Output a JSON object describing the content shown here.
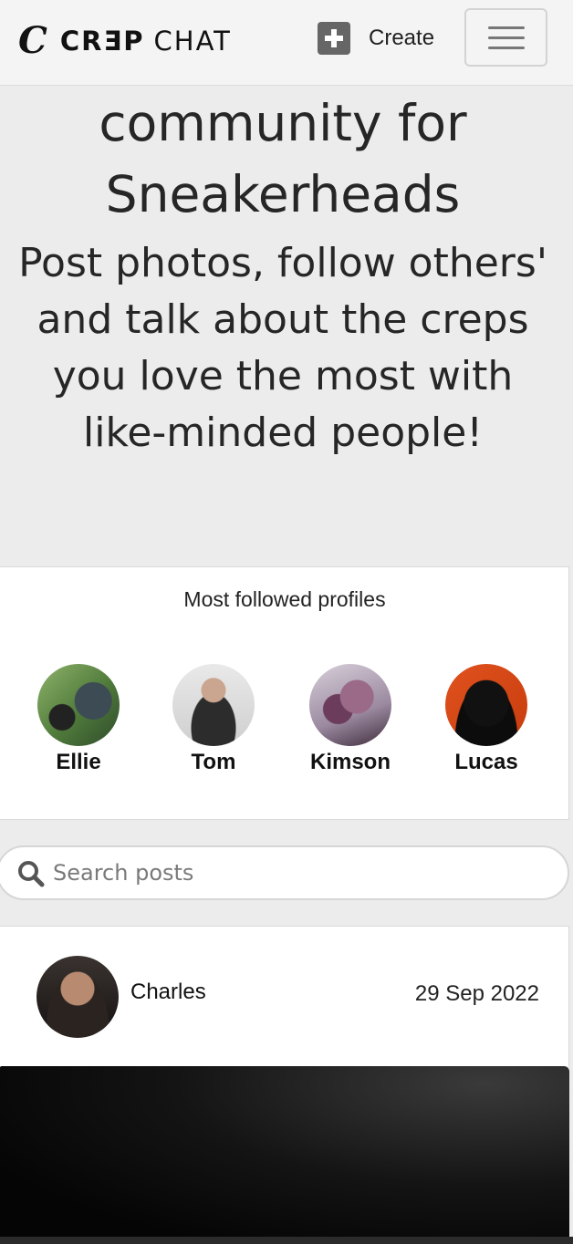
{
  "navbar": {
    "brand_c": "C",
    "brand_crep": "CRƎP",
    "brand_chat": "CHAT",
    "create_label": "Create"
  },
  "hero": {
    "title": "community for Sneakerheads",
    "subtitle": "Post photos, follow others' and talk about the creps you love the most with like-minded people!"
  },
  "profiles": {
    "heading": "Most followed profiles",
    "items": [
      {
        "name": "Ellie"
      },
      {
        "name": "Tom"
      },
      {
        "name": "Kimson"
      },
      {
        "name": "Lucas"
      }
    ]
  },
  "search": {
    "placeholder": "Search posts"
  },
  "post": {
    "author": "Charles",
    "date": "29 Sep 2022"
  }
}
